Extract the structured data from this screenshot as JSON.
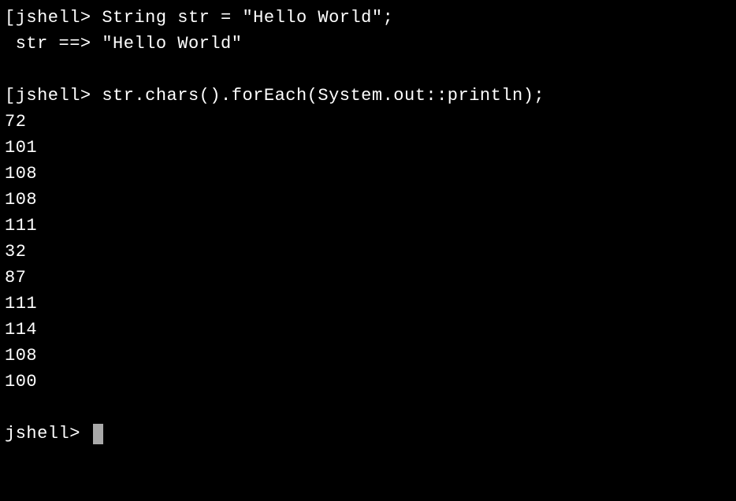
{
  "prompt": "jshell> ",
  "bracket": "[",
  "cmd1": "String str = \"Hello World\";",
  "result1_label": " str ==> ",
  "result1_value": "\"Hello World\"",
  "cmd2": "str.chars().forEach(System.out::println);",
  "outputs": [
    "72",
    "101",
    "108",
    "108",
    "111",
    "32",
    "87",
    "111",
    "114",
    "108",
    "100"
  ],
  "out0": "72",
  "out1": "101",
  "out2": "108",
  "out3": "108",
  "out4": "111",
  "out5": "32",
  "out6": "87",
  "out7": "111",
  "out8": "114",
  "out9": "108",
  "out10": "100"
}
